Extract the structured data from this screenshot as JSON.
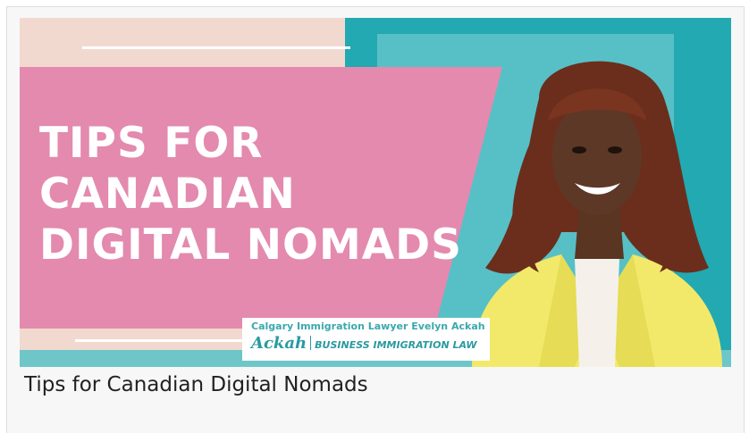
{
  "thumbnail": {
    "headline_lines": [
      "TIPS FOR",
      "CANADIAN",
      "DIGITAL NOMADS"
    ],
    "badge": {
      "line1": "Calgary Immigration Lawyer Evelyn Ackah",
      "logo": "Ackah",
      "tagline": "BUSINESS IMMIGRATION LAW"
    },
    "colors": {
      "pink": "#e38aae",
      "teal": "#22a9b2",
      "blush": "#f2d9d0",
      "jacket": "#f2e96a"
    }
  },
  "caption": "Tips for Canadian Digital Nomads"
}
